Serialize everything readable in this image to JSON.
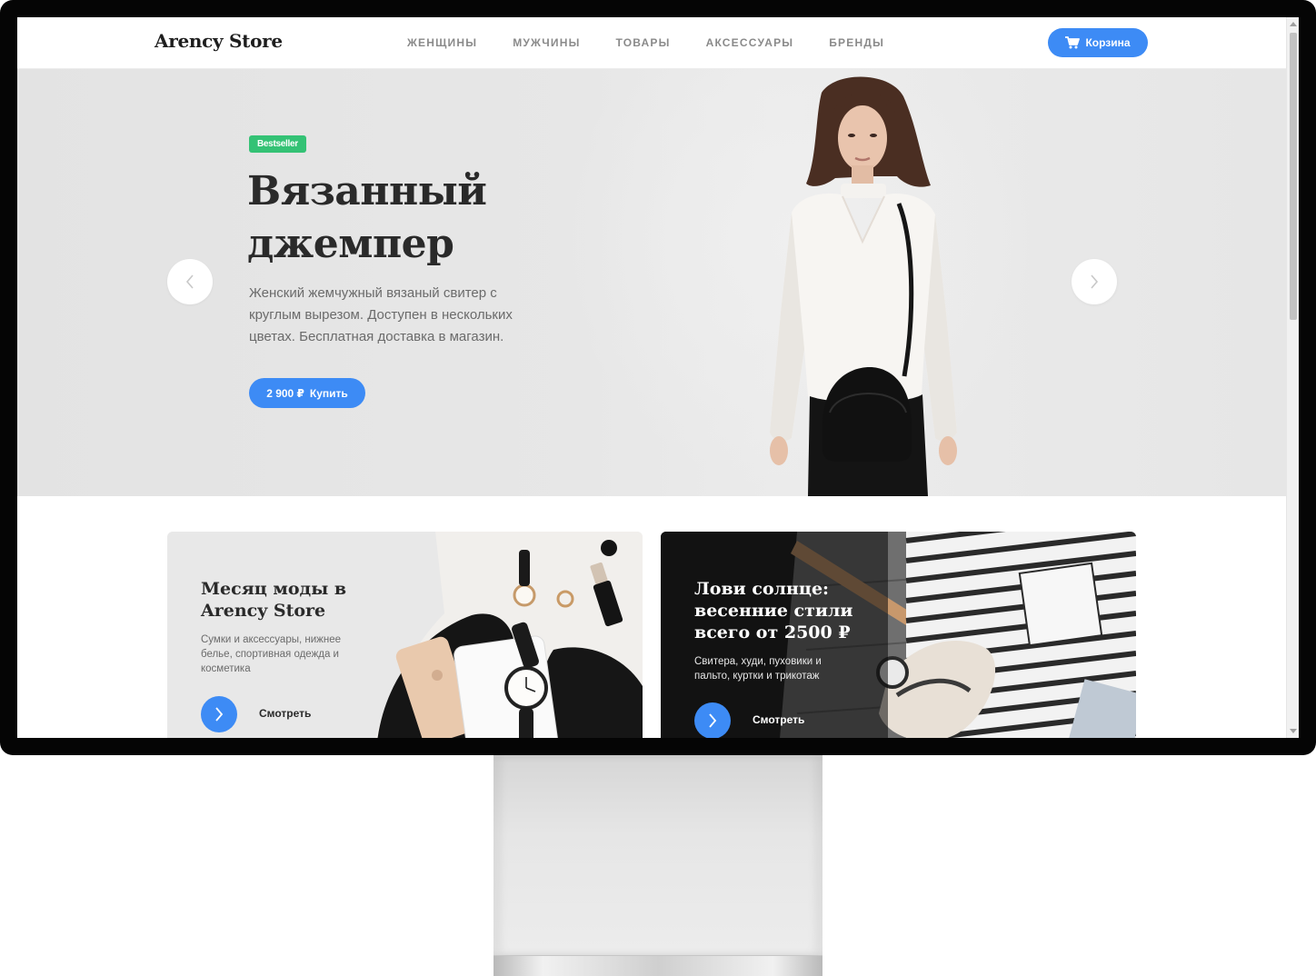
{
  "brand": "Arency Store",
  "nav": {
    "items": [
      "ЖЕНЩИНЫ",
      "МУЖЧИНЫ",
      "ТОВАРЫ",
      "АКСЕССУАРЫ",
      "БРЕНДЫ"
    ],
    "cart_label": "Корзина"
  },
  "hero": {
    "badge": "Bestseller",
    "title_line1": "Вязанный",
    "title_line2": "джемпер",
    "description": "Женский жемчужный вязаный свитер с круглым вырезом. Доступен в нескольких цветах. Бесплатная доставка в магазин.",
    "price": "2 900 ₽",
    "buy_label": "Купить"
  },
  "cards": [
    {
      "title": "Месяц моды в Arency Store",
      "text": "Сумки и аксессуары, нижнее белье, спортивная одежда и косметика",
      "link_label": "Смотреть"
    },
    {
      "title": "Лови солнце: весенние стили всего от 2500 ₽",
      "text": "Свитера, худи, пуховики и пальто, куртки и трикотаж",
      "link_label": "Смотреть"
    }
  ],
  "colors": {
    "accent": "#3d8bf5",
    "badge": "#34c275",
    "hero_bg": "#e6e6e6",
    "card_light": "#e8e8e8",
    "card_dark": "#161616"
  }
}
